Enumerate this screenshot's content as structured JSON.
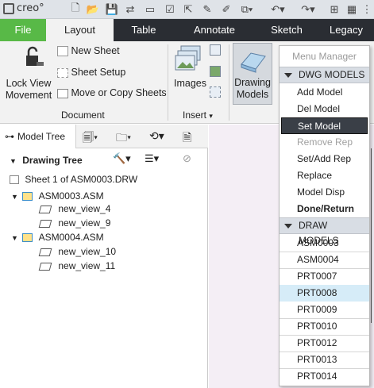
{
  "app": {
    "logo_text": "creo°"
  },
  "ribbon_tabs": [
    {
      "label": "File"
    },
    {
      "label": "Layout"
    },
    {
      "label": "Table"
    },
    {
      "label": "Annotate"
    },
    {
      "label": "Sketch"
    },
    {
      "label": "Legacy"
    }
  ],
  "ribbon": {
    "lock_view_movement": "Lock View\nMovement",
    "new_sheet": "New Sheet",
    "sheet_setup": "Sheet Setup",
    "move_copy_sheets": "Move or Copy Sheets",
    "document_group": "Document",
    "images": "Images",
    "insert_group": "Insert",
    "drawing_models": "Drawing\nModels"
  },
  "left_pane": {
    "model_tree_tab": "Model Tree",
    "drawing_tree": "Drawing Tree",
    "items": [
      {
        "label": "Sheet 1 of ASM0003.DRW"
      },
      {
        "label": "ASM0003.ASM"
      },
      {
        "label": "new_view_4"
      },
      {
        "label": "new_view_9"
      },
      {
        "label": "ASM0004.ASM"
      },
      {
        "label": "new_view_10"
      },
      {
        "label": "new_view_11"
      }
    ]
  },
  "menu": {
    "title": "Menu Manager",
    "section1": "DWG MODELS",
    "items1": [
      {
        "label": "Add Model"
      },
      {
        "label": "Del Model"
      },
      {
        "label": "Set Model"
      },
      {
        "label": "Remove Rep"
      },
      {
        "label": "Set/Add Rep"
      },
      {
        "label": "Replace"
      },
      {
        "label": "Model Disp"
      },
      {
        "label": "Done/Return"
      }
    ],
    "section2": "DRAW MODELS",
    "items2": [
      {
        "label": "ASM0003"
      },
      {
        "label": "ASM0004"
      },
      {
        "label": "PRT0007"
      },
      {
        "label": "PRT0008"
      },
      {
        "label": "PRT0009"
      },
      {
        "label": "PRT0010"
      },
      {
        "label": "PRT0012"
      },
      {
        "label": "PRT0013"
      },
      {
        "label": "PRT0014"
      }
    ]
  },
  "colors": {
    "file_tab": "#58b947",
    "tab_bar": "#2a2d33",
    "menu_selected": "#3a3f47",
    "menu_hover": "#d6ecf8"
  }
}
